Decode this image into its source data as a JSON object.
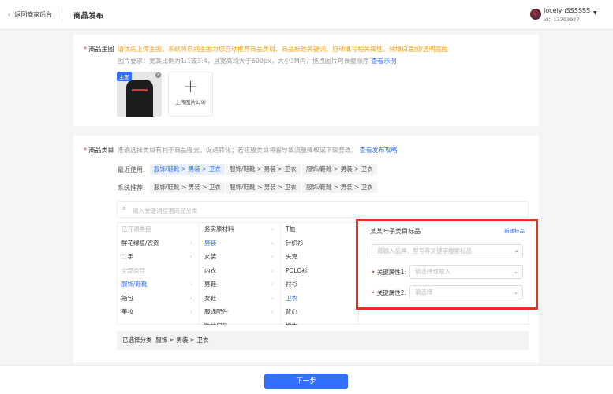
{
  "header": {
    "back_label": "返回商家后台",
    "title": "商品发布",
    "user_name": "JocelynSSSSSS",
    "user_id": "id：13793927"
  },
  "main_image": {
    "label": "商品主图",
    "hint": "请优先上传主图，系统将识别主图为您自动推荐商品类目、商品标题关键词、自动填写相关属性、预填白底图/透明底图",
    "requirement": "图片要求：宽高比例为1:1或3:4，且宽高均大于600px，大小3M内，拖拽图片可调整顺序",
    "example_link": "查看示例",
    "badge": "主图",
    "upload_label": "上传图片1/9)"
  },
  "category": {
    "label": "商品类目",
    "hint": "准确选择类目有利于商品曝光，促进转化；若错放类目将会导致流量降权或下架整改。",
    "guide_link": "查看发布攻略",
    "recent_label": "最近使用:",
    "recent": [
      "服饰/鞋靴 > 男装 > 卫衣",
      "服饰/鞋靴 > 男装 > 卫衣",
      "服饰/鞋靴 > 男装 > 卫衣"
    ],
    "system_label": "系统推荐:",
    "system": [
      "服饰/鞋靴 > 男装 > 卫衣",
      "服饰/鞋靴 > 男装 > 卫衣",
      "服饰/鞋靴 > 男装 > 卫衣"
    ],
    "search_placeholder": "输入关键词搜索商品分类",
    "col1": [
      {
        "t": "已开通类目",
        "type": "label"
      },
      {
        "t": "鲜花绿植/农资",
        "type": "item"
      },
      {
        "t": "二手",
        "type": "item"
      },
      {
        "t": "全部类目",
        "type": "label"
      },
      {
        "t": "服饰/鞋靴",
        "type": "sel"
      },
      {
        "t": "箱包",
        "type": "item"
      },
      {
        "t": "美妆",
        "type": "item"
      }
    ],
    "col2": [
      {
        "t": "务实原材料",
        "type": "item"
      },
      {
        "t": "男装",
        "type": "sel"
      },
      {
        "t": "女装",
        "type": "item"
      },
      {
        "t": "内衣",
        "type": "item"
      },
      {
        "t": "男鞋",
        "type": "item"
      },
      {
        "t": "女鞋",
        "type": "item"
      },
      {
        "t": "服饰配件",
        "type": "item"
      },
      {
        "t": "防护用品",
        "type": "item"
      }
    ],
    "col3": [
      {
        "t": "T恤",
        "type": "leaf"
      },
      {
        "t": "针织衫",
        "type": "leaf"
      },
      {
        "t": "夹克",
        "type": "leaf"
      },
      {
        "t": "POLO衫",
        "type": "leaf"
      },
      {
        "t": "衬衫",
        "type": "leaf"
      },
      {
        "t": "卫衣",
        "type": "sel"
      },
      {
        "t": "背心",
        "type": "leaf"
      },
      {
        "t": "棉衣",
        "type": "leaf"
      }
    ],
    "selected_label": "已选择分类",
    "selected_value": "服饰 > 男装 > 卫衣"
  },
  "standard": {
    "title": "某某叶子类目标品",
    "new_link": "新建标品",
    "search_placeholder": "请输入品牌、型号等关键字搜索标品",
    "attr1_label": "关键属性1:",
    "attr1_placeholder": "请选择或输入",
    "attr2_label": "关键属性2:",
    "attr2_placeholder": "请选择"
  },
  "footer": {
    "next_label": "下一步"
  },
  "colors": {
    "accent": "#3370ff",
    "warning": "#f0a020",
    "highlight_box": "#e8331c"
  }
}
